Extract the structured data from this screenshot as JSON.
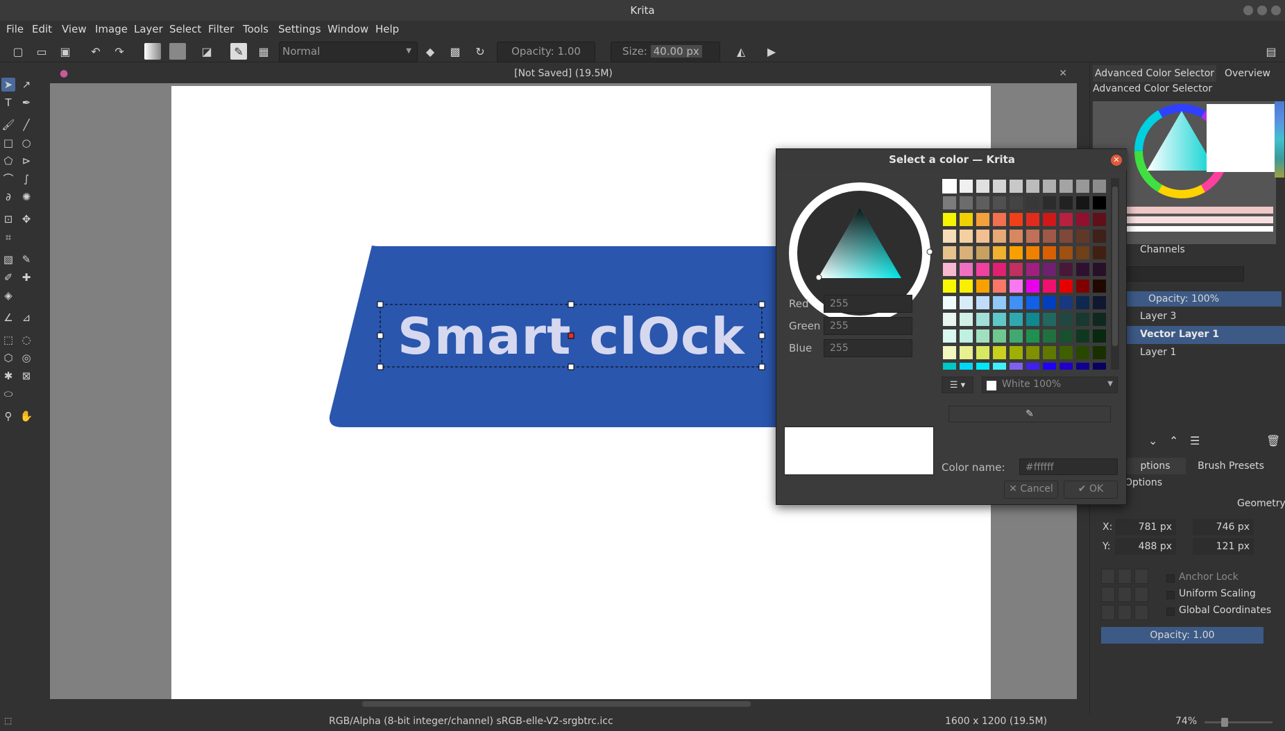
{
  "window": {
    "title": "Krita"
  },
  "menu": [
    "File",
    "Edit",
    "View",
    "Image",
    "Layer",
    "Select",
    "Filter",
    "Tools",
    "Settings",
    "Window",
    "Help"
  ],
  "toolbar": {
    "blend_mode": "Normal",
    "opacity": "Opacity: 1.00",
    "size_label": "Size:",
    "size_value": "40.00 px"
  },
  "document": {
    "tab_title": "[Not Saved]  (19.5M)",
    "text": "Smart clOck"
  },
  "docker": {
    "tab_color_selector": "Advanced Color Selector",
    "tab_overview": "Overview",
    "color_selector_title": "Advanced Color Selector",
    "channels_tab": "Channels",
    "layers_opacity": "Opacity:  100%",
    "layers": [
      {
        "name": "Layer 3",
        "selected": false
      },
      {
        "name": "Vector Layer 1",
        "selected": true
      },
      {
        "name": "Layer 1",
        "selected": false
      }
    ],
    "tool_options_tab": "ptions",
    "brush_presets_tab": "Brush Presets",
    "tool_options_title": "Options",
    "geometry_label": "Geometry",
    "x_label": "X:",
    "x_value": "781 px",
    "w_value": "746 px",
    "y_label": "Y:",
    "y_value": "488 px",
    "h_value": "121 px",
    "anchor_lock": "Anchor Lock",
    "uniform_scaling": "Uniform Scaling",
    "global_coordinates": "Global Coordinates",
    "opacity_bar": "Opacity: 1.00"
  },
  "dialog": {
    "title": "Select a color — Krita",
    "red_label": "Red",
    "red_value": "255",
    "green_label": "Green",
    "green_value": "255",
    "blue_label": "Blue",
    "blue_value": "255",
    "palette_name": "White 100%",
    "color_name_label": "Color name:",
    "color_name_value": "#ffffff",
    "cancel_label": "Cancel",
    "ok_label": "OK",
    "swatches": [
      [
        "#ffffff",
        "#f0f0f0",
        "#e0e0e0",
        "#d4d4d4",
        "#c8c8c8",
        "#bcbcbc",
        "#b0b0b0",
        "#a4a4a4",
        "#989898",
        "#8c8c8c"
      ],
      [
        "#7c7c7c",
        "#6c6c6c",
        "#5e5e5e",
        "#505050",
        "#444444",
        "#383838",
        "#2c2c2c",
        "#222222",
        "#161616",
        "#000000"
      ],
      [
        "#f5f500",
        "#f0d000",
        "#f4a03c",
        "#f07050",
        "#f04018",
        "#e02c1c",
        "#d01818",
        "#b82040",
        "#901030",
        "#601018"
      ],
      [
        "#f6dcb8",
        "#f4d0a0",
        "#f2c090",
        "#e8a878",
        "#d88860",
        "#c07058",
        "#a05848",
        "#804838",
        "#603828",
        "#402018"
      ],
      [
        "#e6c28c",
        "#d8b078",
        "#c8a060",
        "#f0b030",
        "#f8a000",
        "#f08000",
        "#d86000",
        "#a05010",
        "#704018",
        "#402010"
      ],
      [
        "#f8b8d0",
        "#f070c0",
        "#f040a0",
        "#e02070",
        "#c03060",
        "#a02080",
        "#702070",
        "#481838",
        "#301030",
        "#281028"
      ],
      [
        "#f8f800",
        "#f8f000",
        "#f8a000",
        "#f87868",
        "#f878f0",
        "#e800e8",
        "#f01070",
        "#e80000",
        "#800000",
        "#200800"
      ],
      [
        "#f0fcfc",
        "#d8ecf8",
        "#c0dcf8",
        "#90c8f8",
        "#4090f8",
        "#1060e8",
        "#0040c0",
        "#183880",
        "#102850",
        "#101830"
      ],
      [
        "#e8f8f0",
        "#d0f0e8",
        "#a0e0d8",
        "#60c8c8",
        "#30a8b0",
        "#108890",
        "#206860",
        "#204840",
        "#183830",
        "#102820"
      ],
      [
        "#d8f8f0",
        "#c0f0e0",
        "#a0e0c0",
        "#70c890",
        "#40a870",
        "#209050",
        "#207040",
        "#185030",
        "#103820",
        "#082810"
      ],
      [
        "#f0f8c0",
        "#e8f090",
        "#d8e860",
        "#c8d020",
        "#a0b000",
        "#809000",
        "#607800",
        "#406000",
        "#284800",
        "#183000"
      ],
      [
        "#00c8c8",
        "#00d8f8",
        "#00e8f8",
        "#40f0f8",
        "#8060f0",
        "#4020f0",
        "#2000f8",
        "#2000c8",
        "#100090",
        "#080060"
      ]
    ]
  },
  "status": {
    "color_space": "RGB/Alpha (8-bit integer/channel)  sRGB-elle-V2-srgbtrc.icc",
    "dimensions": "1600 x 1200 (19.5M)",
    "zoom": "74%"
  }
}
